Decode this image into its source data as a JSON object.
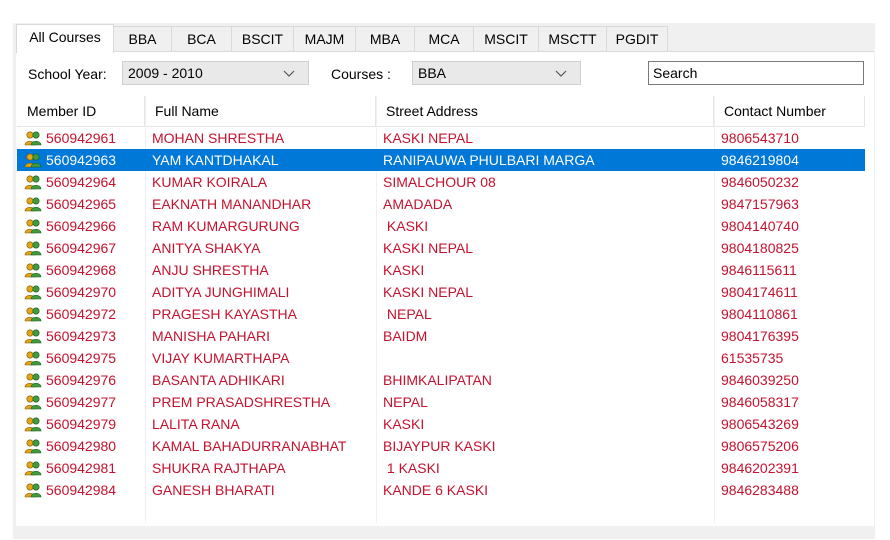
{
  "tabs": [
    "All Courses",
    "BBA",
    "BCA",
    "BSCIT",
    "MAJM",
    "MBA",
    "MCA",
    "MSCIT",
    "MSCTT",
    "PGDIT"
  ],
  "filters": {
    "school_year_label": "School Year:",
    "school_year_value": "2009 - 2010",
    "courses_label": "Courses :",
    "courses_value": "BBA",
    "search_value": "Search"
  },
  "columns": [
    "Member ID",
    "Full Name",
    "Street Address",
    "Contact Number"
  ],
  "selected_index": 1,
  "icon": "users-icon",
  "colors": {
    "row_text": "#c4122f",
    "selection": "#0078d7"
  },
  "rows": [
    {
      "id": "560942961",
      "name": "MOHAN SHRESTHA",
      "address": "KASKI NEPAL",
      "contact": "9806543710"
    },
    {
      "id": "560942963",
      "name": "YAM KANTDHAKAL",
      "address": "RANIPAUWA PHULBARI MARGA",
      "contact": "9846219804"
    },
    {
      "id": "560942964",
      "name": "KUMAR KOIRALA",
      "address": "SIMALCHOUR 08",
      "contact": "9846050232"
    },
    {
      "id": "560942965",
      "name": "EAKNATH MANANDHAR",
      "address": "AMADADA",
      "contact": "9847157963"
    },
    {
      "id": "560942966",
      "name": "RAM KUMARGURUNG",
      "address": " KASKI",
      "contact": "9804140740"
    },
    {
      "id": "560942967",
      "name": "ANITYA SHAKYA",
      "address": "KASKI NEPAL",
      "contact": "9804180825"
    },
    {
      "id": "560942968",
      "name": "ANJU SHRESTHA",
      "address": "KASKI",
      "contact": "9846115611"
    },
    {
      "id": "560942970",
      "name": "ADITYA JUNGHIMALI",
      "address": "KASKI NEPAL",
      "contact": "9804174611"
    },
    {
      "id": "560942972",
      "name": "PRAGESH KAYASTHA",
      "address": " NEPAL",
      "contact": "9804110861"
    },
    {
      "id": "560942973",
      "name": "MANISHA PAHARI",
      "address": "BAIDM",
      "contact": "9804176395"
    },
    {
      "id": "560942975",
      "name": "VIJAY KUMARTHAPA",
      "address": "",
      "contact": "61535735"
    },
    {
      "id": "560942976",
      "name": "BASANTA ADHIKARI",
      "address": "BHIMKALIPATAN",
      "contact": "9846039250"
    },
    {
      "id": "560942977",
      "name": "PREM PRASADSHRESTHA",
      "address": "NEPAL",
      "contact": "9846058317"
    },
    {
      "id": "560942979",
      "name": "LALITA RANA",
      "address": "KASKI",
      "contact": "9806543269"
    },
    {
      "id": "560942980",
      "name": "KAMAL BAHADURRANABHAT",
      "address": "BIJAYPUR KASKI",
      "contact": "9806575206"
    },
    {
      "id": "560942981",
      "name": "SHUKRA RAJTHAPA",
      "address": " 1 KASKI",
      "contact": "9846202391"
    },
    {
      "id": "560942984",
      "name": "GANESH BHARATI",
      "address": "KANDE 6 KASKI",
      "contact": "9846283488"
    }
  ]
}
